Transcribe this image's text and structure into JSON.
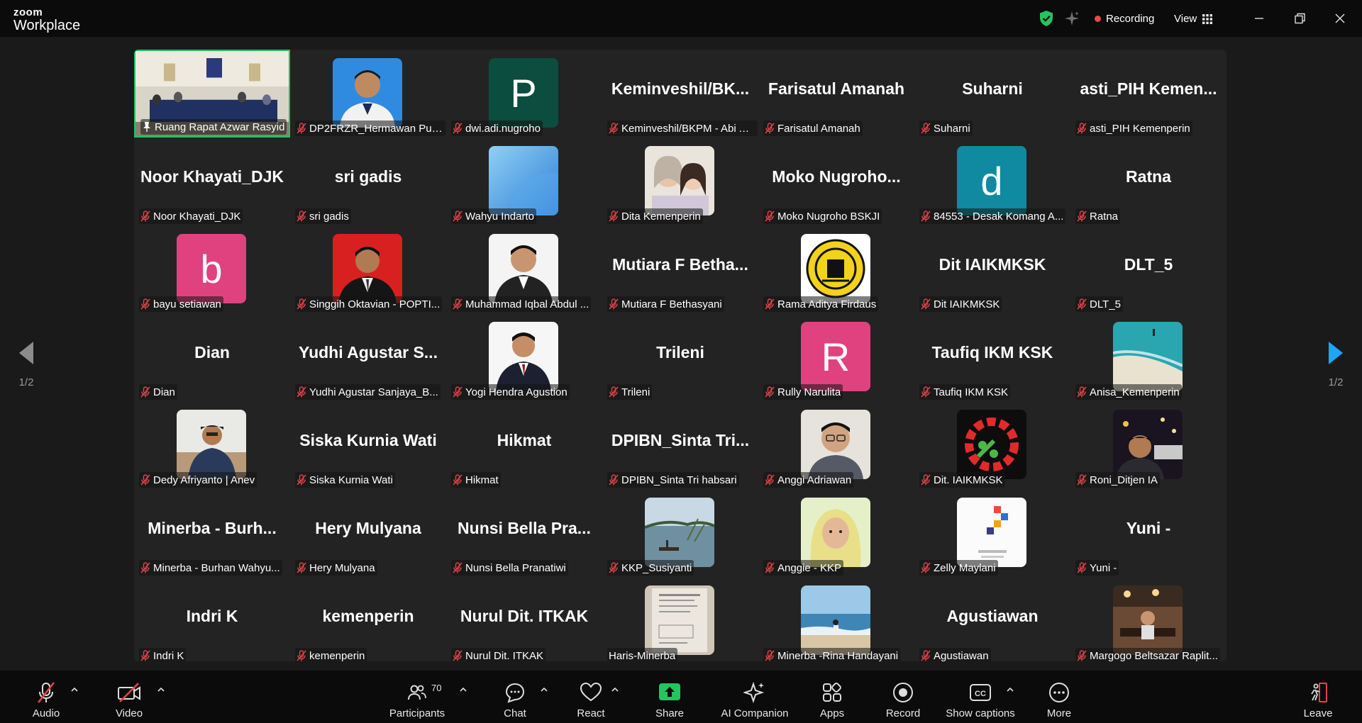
{
  "app": {
    "brand_small": "zoom",
    "brand_big": "Workplace"
  },
  "titlebar": {
    "recording_label": "Recording",
    "view_label": "View"
  },
  "pagination": {
    "left": "1/2",
    "right": "1/2"
  },
  "tiles": [
    {
      "label": "Ruang Rapat Azwar Rasyid",
      "type": "photo",
      "photo": "room"
    },
    {
      "label": "DP2FRZR_Hermawan Puji...",
      "type": "photo",
      "photo": "blue-person"
    },
    {
      "label": "dwi.adi.nugroho",
      "type": "letter",
      "letter": "P",
      "color": "#0b4d3e"
    },
    {
      "label": "Keminveshil/BKPM - Abi Al Ir...",
      "type": "name",
      "title": "Keminveshil/BK..."
    },
    {
      "label": "Farisatul Amanah",
      "type": "name",
      "title": "Farisatul Amanah"
    },
    {
      "label": "Suharni",
      "type": "name",
      "title": "Suharni"
    },
    {
      "label": "asti_PIH Kemenperin",
      "type": "name",
      "title": "asti_PIH  Kemen..."
    },
    {
      "label": "Noor Khayati_DJK",
      "type": "name",
      "title": "Noor Khayati_DJK"
    },
    {
      "label": "sri gadis",
      "type": "name",
      "title": "sri gadis"
    },
    {
      "label": "Wahyu Indarto",
      "type": "photo",
      "photo": "sky"
    },
    {
      "label": "Dita Kemenperin",
      "type": "photo",
      "photo": "two-faces"
    },
    {
      "label": "Moko Nugroho BSKJI",
      "type": "name",
      "title": "Moko Nugroho..."
    },
    {
      "label": "84553 - Desak Komang A...",
      "type": "letter",
      "letter": "d",
      "color": "#0f8aa0"
    },
    {
      "label": "Ratna",
      "type": "name",
      "title": "Ratna"
    },
    {
      "label": "bayu setiawan",
      "type": "letter",
      "letter": "b",
      "color": "#e04280"
    },
    {
      "label": "Singgih Oktavian - POPTI...",
      "type": "photo",
      "photo": "red-person"
    },
    {
      "label": "Muhammad Iqbal Abdul ...",
      "type": "photo",
      "photo": "white-person"
    },
    {
      "label": "Mutiara F Bethasyani",
      "type": "name",
      "title": "Mutiara  F  Betha..."
    },
    {
      "label": "Rama Aditya Firdaus",
      "type": "photo",
      "photo": "emblem"
    },
    {
      "label": "Dit IAIKMKSK",
      "type": "name",
      "title": "Dit IAIKMKSK"
    },
    {
      "label": "DLT_5",
      "type": "name",
      "title": "DLT_5"
    },
    {
      "label": "Dian",
      "type": "name",
      "title": "Dian"
    },
    {
      "label": "Yudhi Agustar Sanjaya_B...",
      "type": "name",
      "title": "Yudhi Agustar S..."
    },
    {
      "label": "Yogi Hendra Agustion",
      "type": "photo",
      "photo": "suit-person"
    },
    {
      "label": "Trileni",
      "type": "name",
      "title": "Trileni"
    },
    {
      "label": "Rully Narulita",
      "type": "letter",
      "letter": "R",
      "color": "#e04280"
    },
    {
      "label": "Taufiq IKM KSK",
      "type": "name",
      "title": "Taufiq IKM KSK"
    },
    {
      "label": "Anisa_Kemenperin",
      "type": "photo",
      "photo": "beach-aerial"
    },
    {
      "label": "Dedy Afriyanto | Anev",
      "type": "photo",
      "photo": "outdoor-person"
    },
    {
      "label": "Siska Kurnia Wati",
      "type": "name",
      "title": "Siska Kurnia Wati"
    },
    {
      "label": "Hikmat",
      "type": "name",
      "title": "Hikmat"
    },
    {
      "label": "DPIBN_Sinta Tri habsari",
      "type": "name",
      "title": "DPIBN_Sinta  Tri..."
    },
    {
      "label": "Anggi Adriawan",
      "type": "photo",
      "photo": "glasses-person"
    },
    {
      "label": "Dit. IAIKMKSK",
      "type": "photo",
      "photo": "gear-logo"
    },
    {
      "label": "Roni_Ditjen IA",
      "type": "photo",
      "photo": "night-selfie"
    },
    {
      "label": "Minerba - Burhan Wahyu...",
      "type": "name",
      "title": "Minerba  -  Burh..."
    },
    {
      "label": "Hery Mulyana",
      "type": "name",
      "title": "Hery Mulyana"
    },
    {
      "label": "Nunsi Bella Pranatiwi",
      "type": "name",
      "title": "Nunsi Bella Pra..."
    },
    {
      "label": "KKP_Susiyanti",
      "type": "photo",
      "photo": "lake"
    },
    {
      "label": "Anggie - KKP",
      "type": "photo",
      "photo": "hijab"
    },
    {
      "label": "Zelly Maylani",
      "type": "photo",
      "photo": "poster"
    },
    {
      "label": "Yuni -",
      "type": "name",
      "title": "Yuni -"
    },
    {
      "label": "Indri K",
      "type": "name",
      "title": "Indri K"
    },
    {
      "label": "kemenperin",
      "type": "name",
      "title": "kemenperin"
    },
    {
      "label": "Nurul Dit. ITKAK",
      "type": "name",
      "title": "Nurul Dit. ITKAK"
    },
    {
      "label": "Haris-Minerba",
      "type": "photo",
      "photo": "document",
      "nomic": true
    },
    {
      "label": "Minerba -Rina Handayani",
      "type": "photo",
      "photo": "sea"
    },
    {
      "label": "Agustiawan",
      "type": "name",
      "title": "Agustiawan"
    },
    {
      "label": "Margogo Beltsazar Raplit...",
      "type": "photo",
      "photo": "restaurant"
    }
  ],
  "toolbar": {
    "audio": "Audio",
    "video": "Video",
    "participants": "Participants",
    "participants_count": "70",
    "chat": "Chat",
    "react": "React",
    "share": "Share",
    "ai_companion": "AI Companion",
    "apps": "Apps",
    "record": "Record",
    "show_captions": "Show captions",
    "more": "More",
    "leave": "Leave"
  },
  "colors": {
    "accent_green": "#22c55e",
    "recording_red": "#e8484e",
    "mic_red": "#e0434a",
    "share_green": "#22c55e"
  }
}
